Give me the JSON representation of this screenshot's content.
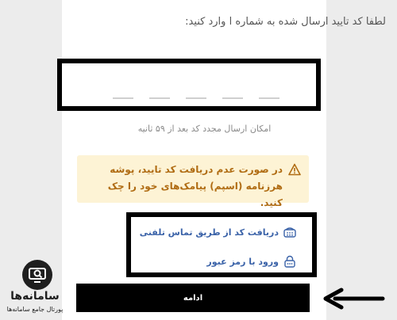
{
  "verification": {
    "instruction": "لطفا کد تایید ارسال شده به شماره ا وارد کنید:",
    "resend_notice": "امکان ارسال مجدد کد بعد از ۵۹ ثانیه"
  },
  "alert": {
    "icon": "warning-icon",
    "text": "در صورت عدم دریافت کد تایید، پوشه هرزنامه (اسپم) پیامک‌های خود را چک کنید.",
    "color": "#b06c13",
    "background": "#fdf3d5"
  },
  "options": [
    {
      "label": "دریافت کد از طریق تماس تلفنی",
      "icon": "phone-icon"
    },
    {
      "label": "ورود با رمز عبور",
      "icon": "lock-icon"
    }
  ],
  "continue_button": {
    "label": "ادامه"
  },
  "watermark": {
    "title": "سامانه‌ها",
    "subtitle": "پورتال جامع سامانه‌ها"
  },
  "colors": {
    "accent_link": "#3a62a8",
    "button_bg": "#000000"
  }
}
